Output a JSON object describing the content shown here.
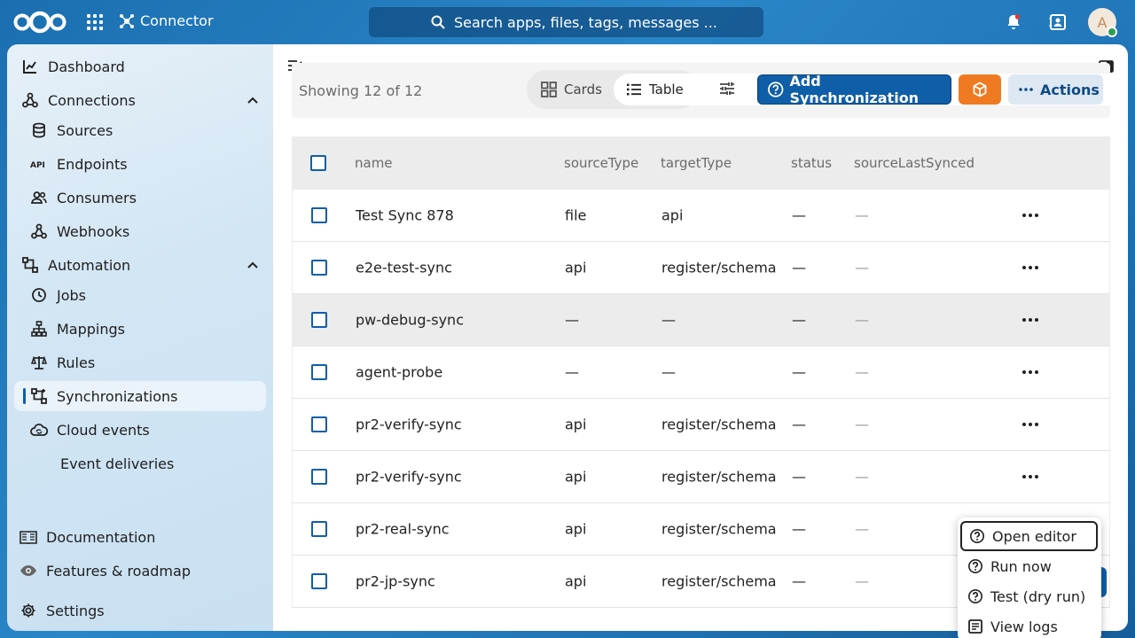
{
  "header": {
    "app_name": "Connector",
    "search_placeholder": "Search apps, files, tags, messages ...",
    "avatar_initial": "A"
  },
  "sidebar": {
    "items": [
      {
        "label": "Dashboard"
      },
      {
        "label": "Connections"
      },
      {
        "label": "Sources"
      },
      {
        "label": "Endpoints"
      },
      {
        "label": "Consumers"
      },
      {
        "label": "Webhooks"
      },
      {
        "label": "Automation"
      },
      {
        "label": "Jobs"
      },
      {
        "label": "Mappings"
      },
      {
        "label": "Rules"
      },
      {
        "label": "Synchronizations"
      },
      {
        "label": "Cloud events"
      },
      {
        "label": "Event deliveries"
      }
    ],
    "footer": [
      {
        "label": "Documentation"
      },
      {
        "label": "Features & roadmap"
      },
      {
        "label": "Settings"
      }
    ]
  },
  "toolbar": {
    "showing": "Showing 12 of 12",
    "view_cards": "Cards",
    "view_table": "Table",
    "add_label": "Add Synchronization",
    "actions_label": "Actions"
  },
  "table": {
    "columns": [
      "name",
      "sourceType",
      "targetType",
      "status",
      "sourceLastSynced"
    ],
    "rows": [
      {
        "name": "Test Sync 878",
        "sourceType": "file",
        "targetType": "api",
        "status": "—",
        "last": "—"
      },
      {
        "name": "e2e-test-sync",
        "sourceType": "api",
        "targetType": "register/schema",
        "status": "—",
        "last": "—"
      },
      {
        "name": "pw-debug-sync",
        "sourceType": "—",
        "targetType": "—",
        "status": "—",
        "last": "—"
      },
      {
        "name": "agent-probe",
        "sourceType": "—",
        "targetType": "—",
        "status": "—",
        "last": "—"
      },
      {
        "name": "pr2-verify-sync",
        "sourceType": "api",
        "targetType": "register/schema",
        "status": "—",
        "last": "—"
      },
      {
        "name": "pr2-verify-sync",
        "sourceType": "api",
        "targetType": "register/schema",
        "status": "—",
        "last": "—"
      },
      {
        "name": "pr2-real-sync",
        "sourceType": "api",
        "targetType": "register/schema",
        "status": "—",
        "last": "—"
      },
      {
        "name": "pr2-jp-sync",
        "sourceType": "api",
        "targetType": "register/schema",
        "status": "—",
        "last": "—"
      }
    ]
  },
  "menu": {
    "items": [
      {
        "label": "Open editor"
      },
      {
        "label": "Run now"
      },
      {
        "label": "Test (dry run)"
      },
      {
        "label": "View logs"
      }
    ]
  }
}
